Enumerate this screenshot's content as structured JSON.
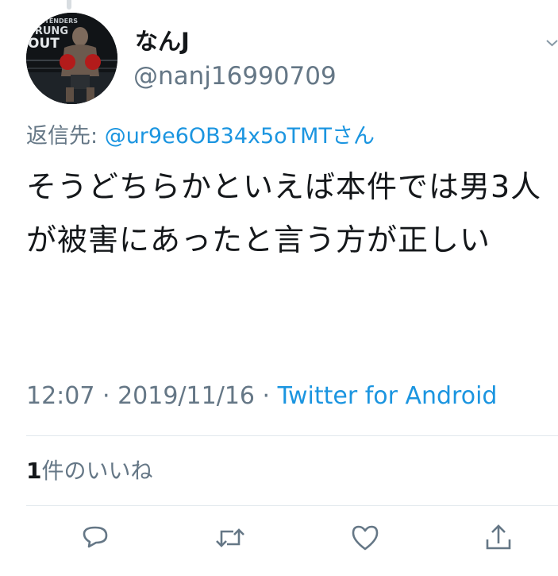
{
  "author": {
    "display_name": "なんJ",
    "handle": "@nanj16990709",
    "avatar_text_top": "CONTENDERS",
    "avatar_text_mid": "TRUNG",
    "avatar_text_bottom": "OUT"
  },
  "reply": {
    "prefix": "返信先: ",
    "mention": "@ur9e6OB34x5oTMTさん"
  },
  "tweet": {
    "text": "そうどちらかといえば本件では男3人が被害にあったと言う方が正しい"
  },
  "meta": {
    "time": "12:07",
    "separator1": " · ",
    "date": "2019/11/16",
    "separator2": " · ",
    "source": "Twitter for Android"
  },
  "likes": {
    "count": "1",
    "label": "件のいいね"
  },
  "actions": {
    "icons": [
      "reply-icon",
      "retweet-icon",
      "like-icon",
      "share-icon"
    ]
  },
  "colors": {
    "link": "#1b95e0",
    "secondary_text": "#657786",
    "primary_text": "#14171a",
    "divider": "#e1e8ed"
  }
}
